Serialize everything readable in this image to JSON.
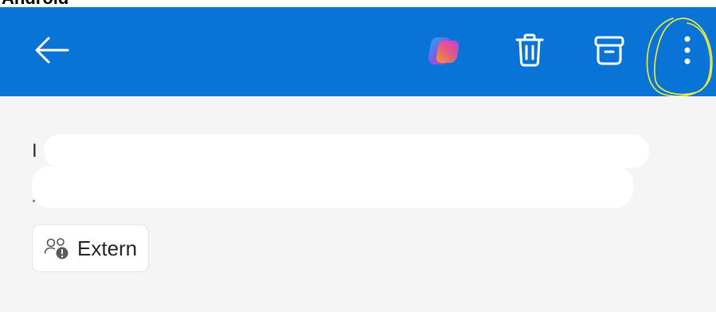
{
  "header": {
    "cut_heading": "Android"
  },
  "toolbar": {
    "back": {
      "icon": "arrow-left-icon"
    },
    "copilot": {
      "icon": "copilot-icon"
    },
    "delete": {
      "icon": "trash-icon"
    },
    "archive": {
      "icon": "archive-icon"
    },
    "more": {
      "icon": "more-vertical-icon"
    },
    "background_color": "#0a74d6"
  },
  "message": {
    "subject_start": "I",
    "sender_tag": {
      "icon": "external-people-icon",
      "label": "Extern"
    }
  }
}
